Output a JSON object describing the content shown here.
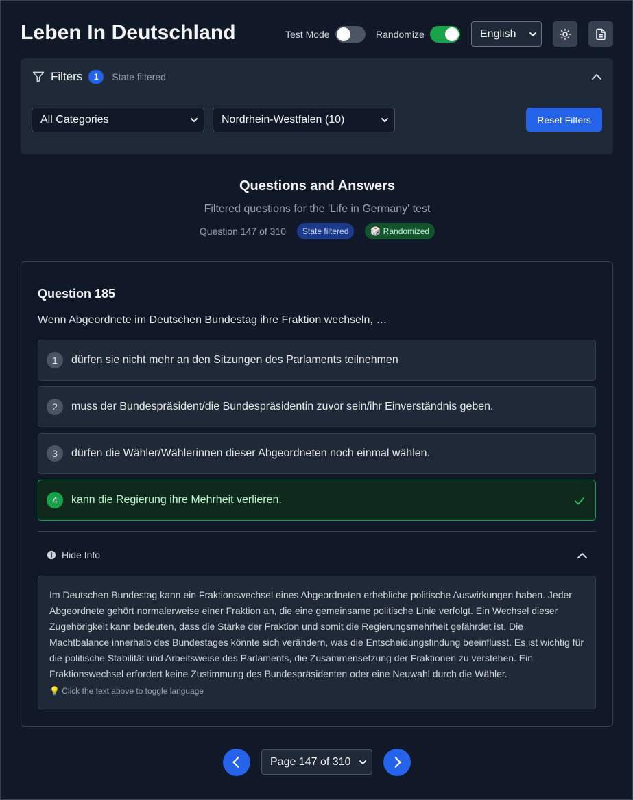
{
  "header": {
    "title": "Leben In Deutschland",
    "test_mode_label": "Test Mode",
    "test_mode_on": false,
    "randomize_label": "Randomize",
    "randomize_on": true,
    "language": "English",
    "theme_icon": "sun-icon",
    "doc_icon": "document-icon"
  },
  "filters": {
    "title": "Filters",
    "count": "1",
    "status": "State filtered",
    "category_value": "All Categories",
    "state_value": "Nordrhein-Westfalen (10)",
    "reset_label": "Reset Filters"
  },
  "section": {
    "title": "Questions and Answers",
    "subtitle": "Filtered questions for the 'Life in Germany' test",
    "progress": "Question 147 of 310",
    "badge_state": "State filtered",
    "badge_random": "🎲 Randomized"
  },
  "question": {
    "number": "Question 185",
    "text": "Wenn Abgeordnete im Deutschen Bundestag ihre Fraktion wechseln, …",
    "answers": [
      {
        "num": "1",
        "text": "dürfen sie nicht mehr an den Sitzungen des Parlaments teilnehmen",
        "correct": false
      },
      {
        "num": "2",
        "text": "muss der Bundespräsident/die Bundespräsidentin zuvor sein/ihr Einverständnis geben.",
        "correct": false
      },
      {
        "num": "3",
        "text": "dürfen die Wähler/Wählerinnen dieser Abgeordneten noch einmal wählen.",
        "correct": false
      },
      {
        "num": "4",
        "text": "kann die Regierung ihre Mehrheit verlieren.",
        "correct": true
      }
    ],
    "info_toggle_label": "Hide Info",
    "info_text": "Im Deutschen Bundestag kann ein Fraktionswechsel eines Abgeordneten erhebliche politische Auswirkungen haben. Jeder Abgeordnete gehört normalerweise einer Fraktion an, die eine gemeinsame politische Linie verfolgt. Ein Wechsel dieser Zugehörigkeit kann bedeuten, dass die Stärke der Fraktion und somit die Regierungsmehrheit gefährdet ist. Die Machtbalance innerhalb des Bundestages könnte sich verändern, was die Entscheidungsfindung beeinflusst. Es ist wichtig für die politische Stabilität und Arbeitsweise des Parlaments, die Zusammensetzung der Fraktionen zu verstehen. Ein Fraktionswechsel erfordert keine Zustimmung des Bundespräsidenten oder eine Neuwahl durch die Wähler.",
    "info_hint": "💡 Click the text above to toggle language"
  },
  "pagination": {
    "page_label": "Page 147 of 310"
  },
  "colors": {
    "background": "#111827",
    "card": "#1f2937",
    "accent": "#2563eb",
    "success": "#16a34a"
  }
}
